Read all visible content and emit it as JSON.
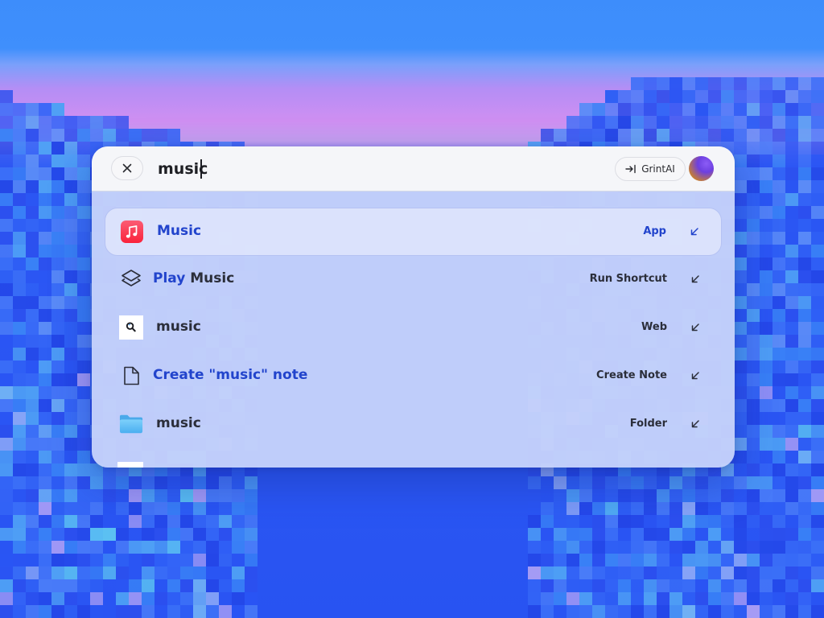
{
  "search": {
    "query": "music",
    "close_label": "×",
    "ai_button_label": "GrintAI"
  },
  "results": [
    {
      "prefix": "",
      "title": "Music",
      "kind": "App",
      "icon": "apple-music-icon",
      "selected": true,
      "title_color": "#2244cc"
    },
    {
      "prefix": "Play",
      "title": "Music",
      "kind": "Run Shortcut",
      "icon": "shortcuts-layers-icon",
      "selected": false
    },
    {
      "prefix": "",
      "title": "music",
      "kind": "Web",
      "icon": "web-search-icon",
      "selected": false
    },
    {
      "prefix": "",
      "title": "Create \"music\" note",
      "kind": "Create Note",
      "icon": "note-document-icon",
      "selected": false,
      "title_color": "#2244cc"
    },
    {
      "prefix": "",
      "title": "music",
      "kind": "Folder",
      "icon": "folder-icon",
      "selected": false
    }
  ],
  "colors": {
    "accent": "#2244cc",
    "palette_bg": "#c4d1fa",
    "search_bg": "#f5f6f9"
  }
}
